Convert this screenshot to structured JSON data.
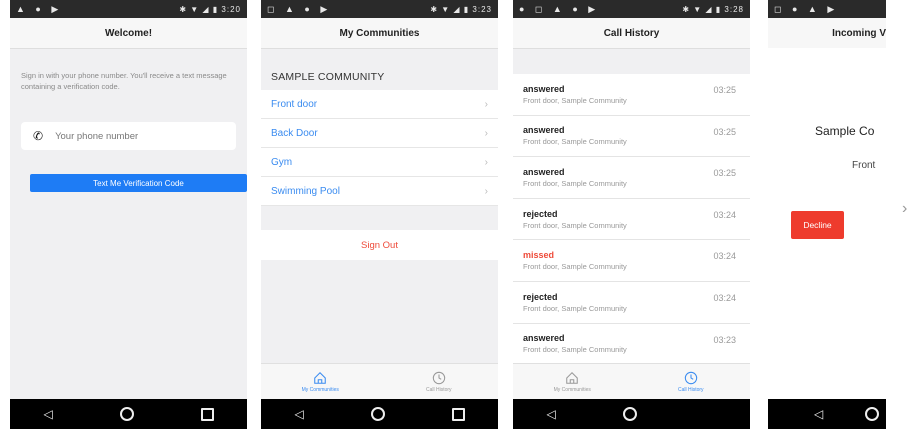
{
  "status_bars": [
    {
      "left": "▲ ● ▶",
      "right": "✱ ▼ ◢ ▮ 3:20"
    },
    {
      "left": "◻ ▲ ● ▶",
      "right": "✱ ▼ ◢ ▮ 3:23"
    },
    {
      "left": "● ◻ ▲ ● ▶",
      "right": "✱ ▼ ◢ ▮ 3:28"
    },
    {
      "left": "◻ ● ▲ ▶",
      "right": ""
    }
  ],
  "screen1": {
    "title": "Welcome!",
    "instructions": "Sign in with your phone number. You'll receive a text message containing a verification code.",
    "phone_placeholder": "Your phone number",
    "verify_button": "Text Me Verification Code"
  },
  "screen2": {
    "title": "My Communities",
    "community": "SAMPLE COMMUNITY",
    "doors": [
      "Front door",
      "Back Door",
      "Gym",
      "Swimming Pool"
    ],
    "sign_out": "Sign Out",
    "tabs": {
      "communities": "My Communities",
      "history": "Call History"
    }
  },
  "screen3": {
    "title": "Call History",
    "calls": [
      {
        "status": "answered",
        "location": "Front door, Sample Community",
        "time": "03:25"
      },
      {
        "status": "answered",
        "location": "Front door, Sample Community",
        "time": "03:25"
      },
      {
        "status": "answered",
        "location": "Front door, Sample Community",
        "time": "03:25"
      },
      {
        "status": "rejected",
        "location": "Front door, Sample Community",
        "time": "03:24"
      },
      {
        "status": "missed",
        "location": "Front door, Sample Community",
        "time": "03:24"
      },
      {
        "status": "rejected",
        "location": "Front door, Sample Community",
        "time": "03:24"
      },
      {
        "status": "answered",
        "location": "Front door, Sample Community",
        "time": "03:23"
      }
    ],
    "tabs": {
      "communities": "My Communities",
      "history": "Call History"
    }
  },
  "screen4": {
    "title": "Incoming V",
    "community": "Sample Co",
    "door": "Front",
    "decline_button": "Decline"
  },
  "colors": {
    "accent": "#1e7cf5",
    "link": "#3b8cf0",
    "danger": "#ee4b3a"
  }
}
